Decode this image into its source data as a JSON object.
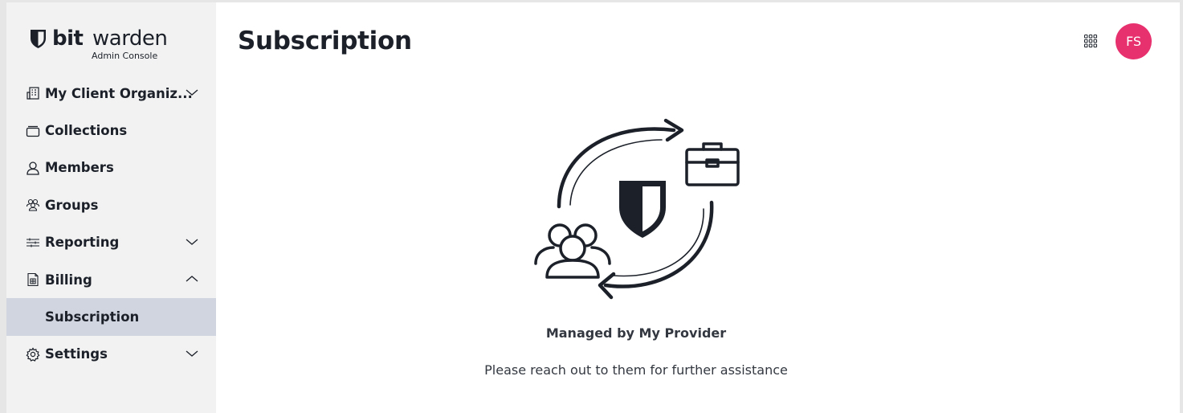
{
  "brand": {
    "name_bold": "bit",
    "name_light": "warden",
    "subtitle": "Admin Console"
  },
  "sidebar": {
    "items": [
      {
        "label": "My Client Organiz...",
        "icon": "organization-icon",
        "chevron": "down"
      },
      {
        "label": "Collections",
        "icon": "collection-icon"
      },
      {
        "label": "Members",
        "icon": "user-icon"
      },
      {
        "label": "Groups",
        "icon": "users-icon"
      },
      {
        "label": "Reporting",
        "icon": "sliders-icon",
        "chevron": "down"
      },
      {
        "label": "Billing",
        "icon": "billing-icon",
        "chevron": "up"
      },
      {
        "label": "Subscription",
        "sub": true,
        "active": true
      },
      {
        "label": "Settings",
        "icon": "gear-icon",
        "chevron": "down"
      }
    ]
  },
  "header": {
    "title": "Subscription",
    "apps_icon": "app-grid-icon",
    "avatar_initials": "FS",
    "avatar_color": "#e7306e"
  },
  "main": {
    "illustration": "provider-managed-illustration",
    "title": "Managed by My Provider",
    "message": "Please reach out to them for further assistance"
  },
  "colors": {
    "sidebar_bg": "#f2f2f2",
    "active_bg": "#d1d5df",
    "text": "#1b2029"
  }
}
